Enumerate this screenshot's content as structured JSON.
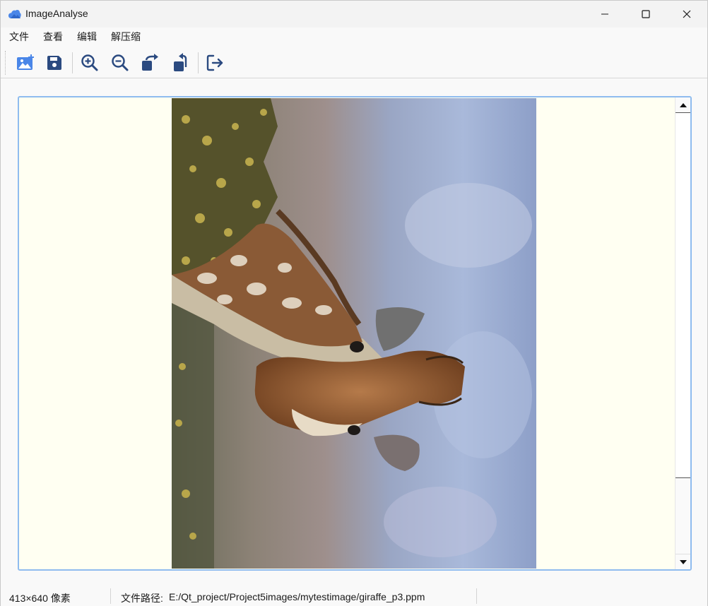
{
  "app": {
    "title": "ImageAnalyse",
    "icon": "cloud-icon",
    "accent_color": "#4a86e8"
  },
  "window_controls": {
    "minimize_icon": "minimize-icon",
    "maximize_icon": "maximize-icon",
    "close_icon": "close-icon"
  },
  "menu": {
    "items": [
      {
        "label": "文件"
      },
      {
        "label": "查看"
      },
      {
        "label": "编辑"
      },
      {
        "label": "解压缩"
      }
    ]
  },
  "toolbar": {
    "icon_color": "#2b4a80",
    "buttons": [
      {
        "icon": "open-image-icon"
      },
      {
        "icon": "save-icon"
      },
      {
        "icon": "zoom-in-icon"
      },
      {
        "icon": "zoom-out-icon"
      },
      {
        "icon": "rotate-right-icon"
      },
      {
        "icon": "rotate-left-icon"
      },
      {
        "icon": "exit-icon"
      }
    ]
  },
  "viewer": {
    "background_color": "#fffff2",
    "frame_color": "#8fbcef",
    "image_subject": "giraffe rotated 90 degrees"
  },
  "status": {
    "size_text": "413×640 像素",
    "path_label": "文件路径:",
    "path": "E:/Qt_project/Project5images/mytestimage/giraffe_p3.ppm"
  }
}
